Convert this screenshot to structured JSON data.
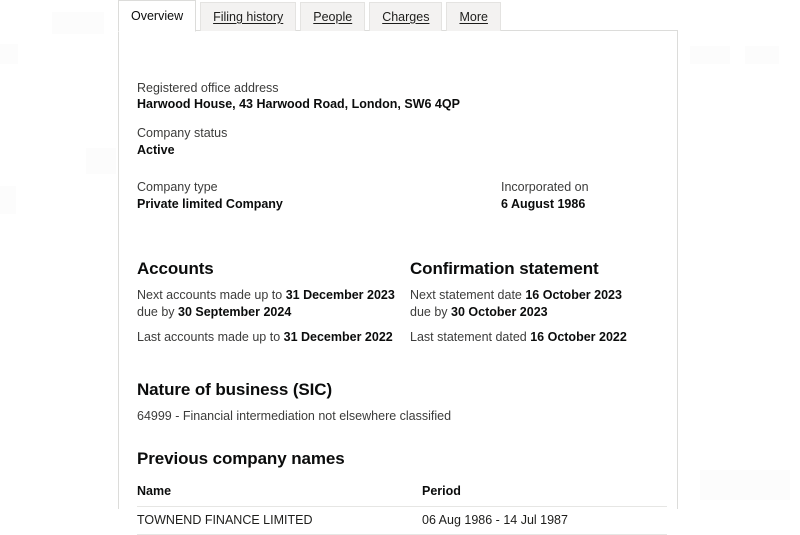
{
  "tabs": [
    {
      "label": "Overview",
      "name": "tab-overview",
      "active": true
    },
    {
      "label": "Filing history",
      "name": "tab-filing-history",
      "active": false
    },
    {
      "label": "People",
      "name": "tab-people",
      "active": false
    },
    {
      "label": "Charges",
      "name": "tab-charges",
      "active": false
    },
    {
      "label": "More",
      "name": "tab-more",
      "active": false
    }
  ],
  "overview": {
    "registered_office_address": {
      "label": "Registered office address",
      "value": "Harwood House, 43 Harwood Road, London, SW6 4QP"
    },
    "company_status": {
      "label": "Company status",
      "value": "Active"
    },
    "company_type": {
      "label": "Company type",
      "value": "Private limited Company"
    },
    "incorporated_on": {
      "label": "Incorporated on",
      "value": "6 August 1986"
    }
  },
  "accounts": {
    "heading": "Accounts",
    "next_prefix": "Next accounts made up to ",
    "next_date": "31 December 2023",
    "due_prefix": "due by ",
    "due_date": "30 September 2024",
    "last_prefix": "Last accounts made up to ",
    "last_date": "31 December 2022"
  },
  "confirmation_statement": {
    "heading": "Confirmation statement",
    "next_prefix": "Next statement date ",
    "next_date": "16 October 2023",
    "due_prefix": "due by ",
    "due_date": "30 October 2023",
    "last_prefix": "Last statement dated ",
    "last_date": "16 October 2022"
  },
  "nature_of_business": {
    "heading": "Nature of business (SIC)",
    "sic_code_description": "64999 - Financial intermediation not elsewhere classified"
  },
  "previous_company_names": {
    "heading": "Previous company names",
    "columns": [
      "Name",
      "Period"
    ],
    "rows": [
      {
        "name": "TOWNEND FINANCE LIMITED",
        "period": "06 Aug 1986 - 14 Jul 1987"
      }
    ]
  },
  "colors": {
    "panel_border": "#dcdcda",
    "tab_inactive_bg": "#f3f2f1",
    "text_primary": "#0b0c0c",
    "text_secondary": "#3c3c3b",
    "table_rule": "#e6e6e4"
  }
}
